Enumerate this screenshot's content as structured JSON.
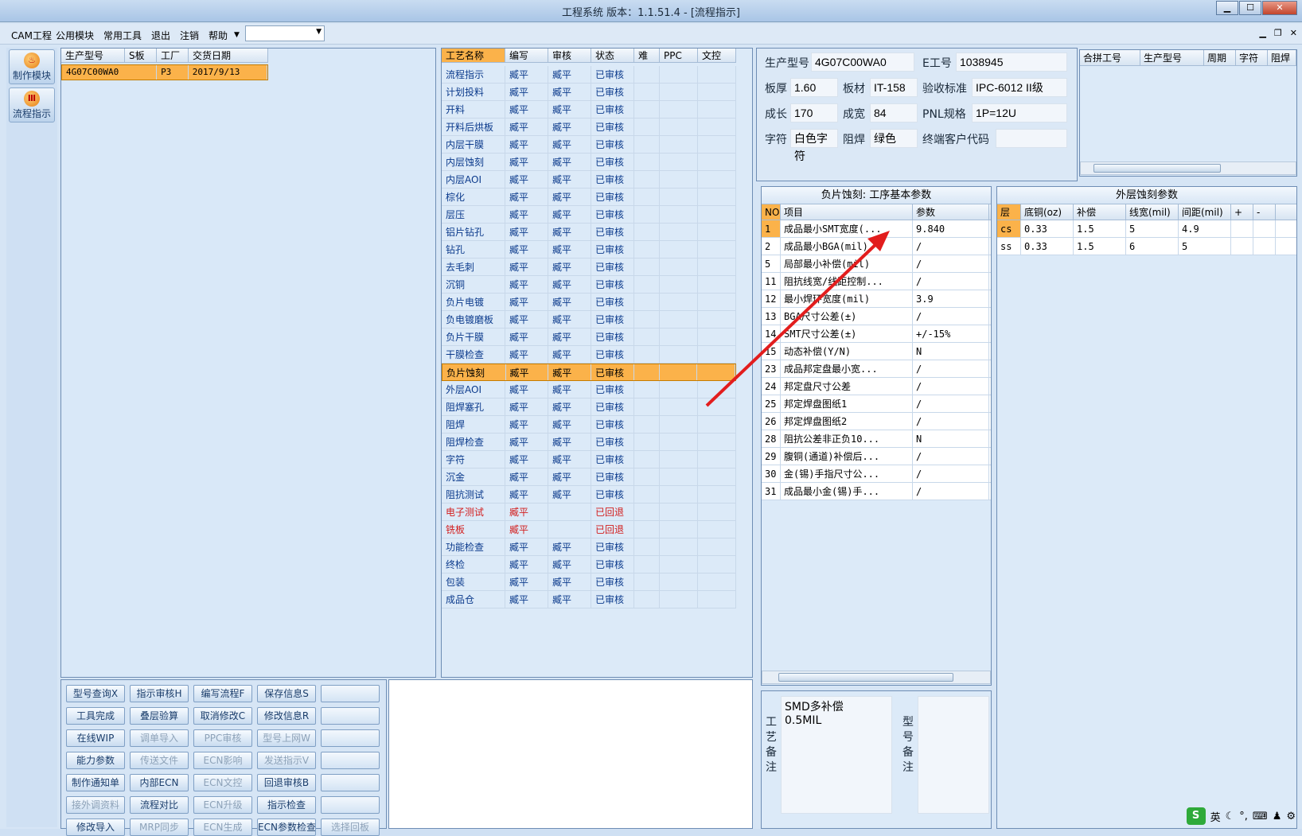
{
  "window": {
    "title": "工程系统   版本：1.1.51.4 - [流程指示]"
  },
  "menu": {
    "items": [
      "CAM工程",
      "公用模块",
      "常用工具",
      "退出",
      "注销",
      "帮助"
    ],
    "dropdown_value": ""
  },
  "left_nav": [
    {
      "label": "制作模块",
      "icon": "flame-icon"
    },
    {
      "label": "流程指示",
      "icon": "flow-icon"
    }
  ],
  "model_list": {
    "headers": [
      "生产型号",
      "S板",
      "工厂",
      "交货日期"
    ],
    "rows": [
      [
        "4G07C00WA0",
        "",
        "P3",
        "2017/9/13"
      ]
    ]
  },
  "process_list": {
    "headers": [
      "工艺名称",
      "编写",
      "审核",
      "状态",
      "难",
      "PPC",
      "文控"
    ],
    "rows": [
      {
        "name": "流程指示",
        "writer": "臧平",
        "reviewer": "臧平",
        "status": "已审核"
      },
      {
        "name": "计划投料",
        "writer": "臧平",
        "reviewer": "臧平",
        "status": "已审核"
      },
      {
        "name": "开料",
        "writer": "臧平",
        "reviewer": "臧平",
        "status": "已审核"
      },
      {
        "name": "开料后烘板",
        "writer": "臧平",
        "reviewer": "臧平",
        "status": "已审核"
      },
      {
        "name": "内层干膜",
        "writer": "臧平",
        "reviewer": "臧平",
        "status": "已审核"
      },
      {
        "name": "内层蚀刻",
        "writer": "臧平",
        "reviewer": "臧平",
        "status": "已审核"
      },
      {
        "name": "内层AOI",
        "writer": "臧平",
        "reviewer": "臧平",
        "status": "已审核"
      },
      {
        "name": "棕化",
        "writer": "臧平",
        "reviewer": "臧平",
        "status": "已审核"
      },
      {
        "name": "层压",
        "writer": "臧平",
        "reviewer": "臧平",
        "status": "已审核"
      },
      {
        "name": "铝片钻孔",
        "writer": "臧平",
        "reviewer": "臧平",
        "status": "已审核"
      },
      {
        "name": "钻孔",
        "writer": "臧平",
        "reviewer": "臧平",
        "status": "已审核"
      },
      {
        "name": "去毛刺",
        "writer": "臧平",
        "reviewer": "臧平",
        "status": "已审核"
      },
      {
        "name": "沉铜",
        "writer": "臧平",
        "reviewer": "臧平",
        "status": "已审核"
      },
      {
        "name": "负片电镀",
        "writer": "臧平",
        "reviewer": "臧平",
        "status": "已审核"
      },
      {
        "name": "负电镀磨板",
        "writer": "臧平",
        "reviewer": "臧平",
        "status": "已审核"
      },
      {
        "name": "负片干膜",
        "writer": "臧平",
        "reviewer": "臧平",
        "status": "已审核"
      },
      {
        "name": "干膜检查",
        "writer": "臧平",
        "reviewer": "臧平",
        "status": "已审核"
      },
      {
        "name": "负片蚀刻",
        "writer": "臧平",
        "reviewer": "臧平",
        "status": "已审核",
        "selected": true
      },
      {
        "name": "外层AOI",
        "writer": "臧平",
        "reviewer": "臧平",
        "status": "已审核"
      },
      {
        "name": "阻焊塞孔",
        "writer": "臧平",
        "reviewer": "臧平",
        "status": "已审核"
      },
      {
        "name": "阻焊",
        "writer": "臧平",
        "reviewer": "臧平",
        "status": "已审核"
      },
      {
        "name": "阻焊检查",
        "writer": "臧平",
        "reviewer": "臧平",
        "status": "已审核"
      },
      {
        "name": "字符",
        "writer": "臧平",
        "reviewer": "臧平",
        "status": "已审核"
      },
      {
        "name": "沉金",
        "writer": "臧平",
        "reviewer": "臧平",
        "status": "已审核"
      },
      {
        "name": "阻抗测试",
        "writer": "臧平",
        "reviewer": "臧平",
        "status": "已审核"
      },
      {
        "name": "电子测试",
        "writer": "臧平",
        "reviewer": "",
        "status": "已回退",
        "returned": true
      },
      {
        "name": "铣板",
        "writer": "臧平",
        "reviewer": "",
        "status": "已回退",
        "returned": true
      },
      {
        "name": "功能检查",
        "writer": "臧平",
        "reviewer": "臧平",
        "status": "已审核"
      },
      {
        "name": "终检",
        "writer": "臧平",
        "reviewer": "臧平",
        "status": "已审核"
      },
      {
        "name": "包装",
        "writer": "臧平",
        "reviewer": "臧平",
        "status": "已审核"
      },
      {
        "name": "成品仓",
        "writer": "臧平",
        "reviewer": "臧平",
        "status": "已审核"
      }
    ]
  },
  "info": {
    "model_label": "生产型号",
    "model": "4G07C00WA0",
    "e_label": "E工号",
    "e_no": "1038945",
    "thick_label": "板厚",
    "thick": "1.60",
    "mat_label": "板材",
    "mat": "IT-158",
    "std_label": "验收标准",
    "std": "IPC-6012 II级",
    "len_label": "成长",
    "len": "170",
    "wid_label": "成宽",
    "wid": "84",
    "pnl_label": "PNL规格",
    "pnl": "1P=12U",
    "char_label": "字符",
    "char": "白色字符",
    "mask_label": "阻焊",
    "mask": "绿色",
    "cust_label": "终端客户代码",
    "cust": ""
  },
  "merge_table": {
    "headers": [
      "合拼工号",
      "生产型号",
      "周期",
      "字符",
      "阻焊"
    ]
  },
  "basic_params": {
    "title": "负片蚀刻: 工序基本参数",
    "headers": [
      "NO",
      "项目",
      "参数"
    ],
    "rows": [
      [
        "1",
        "成品最小SMT宽度(...",
        "9.840"
      ],
      [
        "2",
        "成品最小BGA(mil)",
        "/"
      ],
      [
        "5",
        "局部最小补偿(mil)",
        "/"
      ],
      [
        "11",
        "阻抗线宽/线距控制...",
        "/"
      ],
      [
        "12",
        "最小焊环宽度(mil)",
        "3.9"
      ],
      [
        "13",
        "BGA尺寸公差(±)",
        "/"
      ],
      [
        "14",
        "SMT尺寸公差(±)",
        "+/-15%"
      ],
      [
        "15",
        "动态补偿(Y/N)",
        "N"
      ],
      [
        "23",
        "成品邦定盘最小宽...",
        "/"
      ],
      [
        "24",
        "邦定盘尺寸公差",
        "/"
      ],
      [
        "25",
        "邦定焊盘图纸1",
        "/"
      ],
      [
        "26",
        "邦定焊盘图纸2",
        "/"
      ],
      [
        "28",
        "阻抗公差非正负10...",
        "N"
      ],
      [
        "29",
        "腹铜(通道)补偿后...",
        "/"
      ],
      [
        "30",
        "金(锡)手指尺寸公...",
        "/"
      ],
      [
        "31",
        "成品最小金(锡)手...",
        "/"
      ]
    ]
  },
  "outer_params": {
    "title": "外层蚀刻参数",
    "headers": [
      "层",
      "底铜(oz)",
      "补偿",
      "线宽(mil)",
      "间距(mil)",
      "+",
      "-"
    ],
    "rows": [
      [
        "cs",
        "0.33",
        "1.5",
        "5",
        "4.9",
        "",
        ""
      ],
      [
        "ss",
        "0.33",
        "1.5",
        "6",
        "5",
        "",
        ""
      ]
    ]
  },
  "remarks": {
    "proc_label": "工艺备注",
    "proc_text": "SMD多补偿\n0.5MIL",
    "model_label": "型号备注",
    "model_text": ""
  },
  "buttons": [
    [
      {
        "l": "型号查询X"
      },
      {
        "l": "指示审核H"
      },
      {
        "l": "编写流程F"
      },
      {
        "l": "保存信息S"
      },
      {
        "l": ""
      }
    ],
    [
      {
        "l": "工具完成"
      },
      {
        "l": "叠层验算"
      },
      {
        "l": "取消修改C"
      },
      {
        "l": "修改信息R"
      },
      {
        "l": ""
      }
    ],
    [
      {
        "l": "在线WIP"
      },
      {
        "l": "调单导入",
        "d": 1
      },
      {
        "l": "PPC审核",
        "d": 1
      },
      {
        "l": "型号上网W",
        "d": 1
      },
      {
        "l": ""
      }
    ],
    [
      {
        "l": "能力参数"
      },
      {
        "l": "传送文件",
        "d": 1
      },
      {
        "l": "ECN影响",
        "d": 1
      },
      {
        "l": "发送指示V",
        "d": 1
      },
      {
        "l": ""
      }
    ],
    [
      {
        "l": "制作通知单"
      },
      {
        "l": "内部ECN"
      },
      {
        "l": "ECN文控",
        "d": 1
      },
      {
        "l": "回退审核B"
      },
      {
        "l": ""
      }
    ],
    [
      {
        "l": "接外调资料",
        "d": 1
      },
      {
        "l": "流程对比"
      },
      {
        "l": "ECN升级",
        "d": 1
      },
      {
        "l": "指示检查"
      },
      {
        "l": ""
      }
    ],
    [
      {
        "l": "修改导入"
      },
      {
        "l": "MRP同步",
        "d": 1
      },
      {
        "l": "ECN生成",
        "d": 1
      },
      {
        "l": "ECN参数检查"
      },
      {
        "l": "选择回板",
        "d": 1
      }
    ]
  ],
  "tray": {
    "ime": "英"
  }
}
